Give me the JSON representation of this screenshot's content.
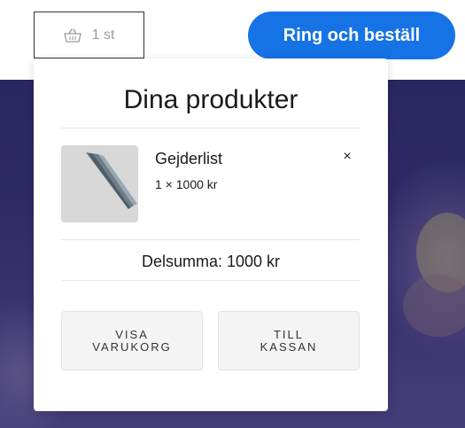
{
  "header": {
    "cart_count": "1 st",
    "cta_label": "Ring och beställ",
    "cart_icon": "basket-icon"
  },
  "cart": {
    "title": "Dina produkter",
    "items": [
      {
        "name": "Gejderlist",
        "quantity_price": "1 × 1000 kr",
        "remove_label": "×"
      }
    ],
    "subtotal": "Delsumma: 1000 kr",
    "view_cart_label": "Visa varukorg",
    "checkout_label": "Till kassan"
  },
  "colors": {
    "accent": "#1673e6"
  }
}
